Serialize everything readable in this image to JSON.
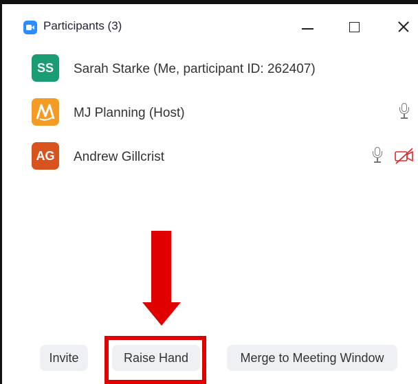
{
  "window": {
    "title": "Participants (3)",
    "accent_color": "#2d8cff"
  },
  "participants": [
    {
      "initials": "SS",
      "name": "Sarah Starke (Me, participant ID: 262407)",
      "avatar_color": "#1a9c75",
      "mic": "none",
      "video": "none"
    },
    {
      "initials": "MJ",
      "name": "MJ Planning (Host)",
      "avatar_color": "#f59a23",
      "mic": "on",
      "video": "none"
    },
    {
      "initials": "AG",
      "name": "Andrew Gillcrist",
      "avatar_color": "#d9531e",
      "mic": "on",
      "video": "off"
    }
  ],
  "buttons": {
    "invite": "Invite",
    "raise_hand": "Raise Hand",
    "merge": "Merge to Meeting Window"
  },
  "annotation": {
    "color": "#e00000"
  }
}
